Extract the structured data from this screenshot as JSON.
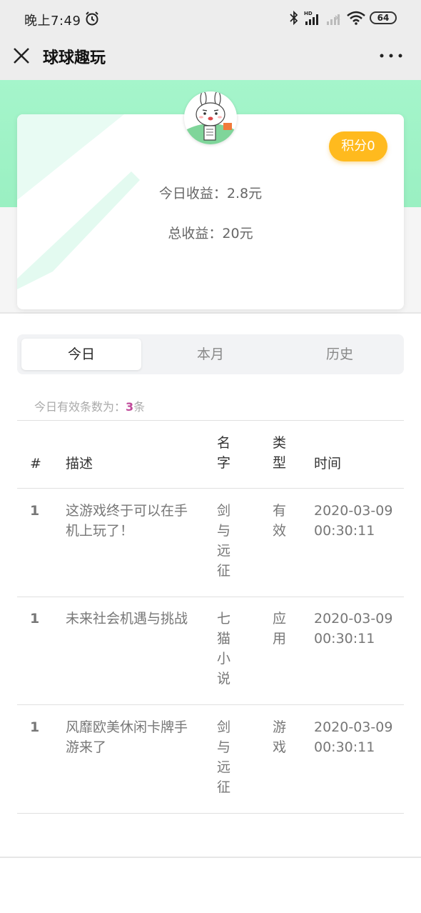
{
  "status_bar": {
    "time": "晚上7:49",
    "battery": "64",
    "icons": [
      "alarm-icon",
      "bluetooth-icon",
      "signal-hd-icon",
      "signal-no-service-icon",
      "wifi-icon",
      "battery-icon"
    ]
  },
  "nav": {
    "title": "球球趣玩",
    "close_icon": "close-icon",
    "more_icon": "more-icon"
  },
  "colors": {
    "hero_green": "#9af0c2",
    "badge_orange": "#ffba1e",
    "count_accent": "#c0499a"
  },
  "profile": {
    "avatar_icon": "bunny-avatar-icon",
    "points_label": "积分0",
    "today_income": "今日收益：2.8元",
    "total_income": "总收益：20元"
  },
  "tabs": [
    {
      "label": "今日",
      "active": true
    },
    {
      "label": "本月",
      "active": false
    },
    {
      "label": "历史",
      "active": false
    }
  ],
  "summary": {
    "prefix": "今日有效条数为：",
    "count": "3",
    "suffix": "条"
  },
  "table": {
    "headers": {
      "index": "#",
      "desc": "描述",
      "name": "名字",
      "type": "类型",
      "time": "时间"
    },
    "rows": [
      {
        "index": "1",
        "desc": "这游戏终于可以在手机上玩了！",
        "name": "剑与远征",
        "type": "有效",
        "time": "2020-03-09 00:30:11"
      },
      {
        "index": "1",
        "desc": "未来社会机遇与挑战",
        "name": "七猫小说",
        "type": "应用",
        "time": "2020-03-09 00:30:11"
      },
      {
        "index": "1",
        "desc": "风靡欧美休闲卡牌手游来了",
        "name": "剑与远征",
        "type": "游戏",
        "time": "2020-03-09 00:30:11"
      }
    ]
  }
}
